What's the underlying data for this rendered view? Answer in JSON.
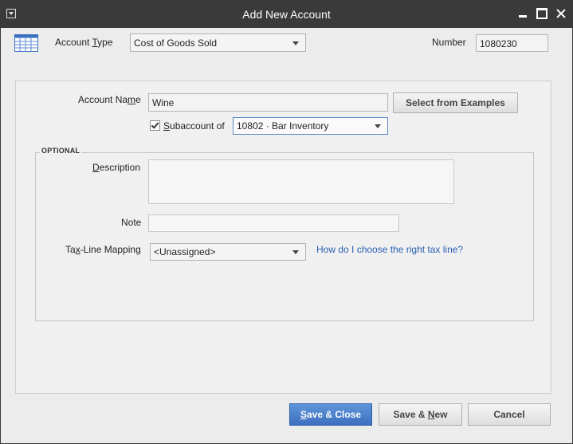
{
  "window": {
    "title": "Add New Account"
  },
  "header": {
    "account_type_label": {
      "pre": "Account ",
      "key": "T",
      "post": "ype"
    },
    "account_type_value": "Cost of Goods Sold",
    "number_label": "Number",
    "number_value": "1080230"
  },
  "form": {
    "account_name_label": {
      "pre": "Account Na",
      "key": "m",
      "post": "e"
    },
    "account_name_value": "Wine",
    "select_examples_button": "Select from Examples",
    "subaccount_checked": true,
    "subaccount_label": {
      "pre": "",
      "key": "S",
      "post": "ubaccount of"
    },
    "subaccount_value": "10802 · Bar Inventory"
  },
  "optional": {
    "title": "OPTIONAL",
    "description_label": {
      "pre": "",
      "key": "D",
      "post": "escription"
    },
    "description_value": "",
    "note_label": "Note",
    "note_value": "",
    "tax_line_label": {
      "pre": "Ta",
      "key": "x",
      "post": "-Line Mapping"
    },
    "tax_line_value": "<Unassigned>",
    "tax_help_link": "How do I choose the right tax line?"
  },
  "footer": {
    "save_close": {
      "pre": "",
      "key": "S",
      "post": "ave & Close"
    },
    "save_new": {
      "pre": "Save & ",
      "key": "N",
      "post": "ew"
    },
    "cancel": "Cancel"
  },
  "colors": {
    "titlebar": "#3a3a3a",
    "primary_button": "#4a7fcc",
    "link": "#2b5fb4"
  }
}
